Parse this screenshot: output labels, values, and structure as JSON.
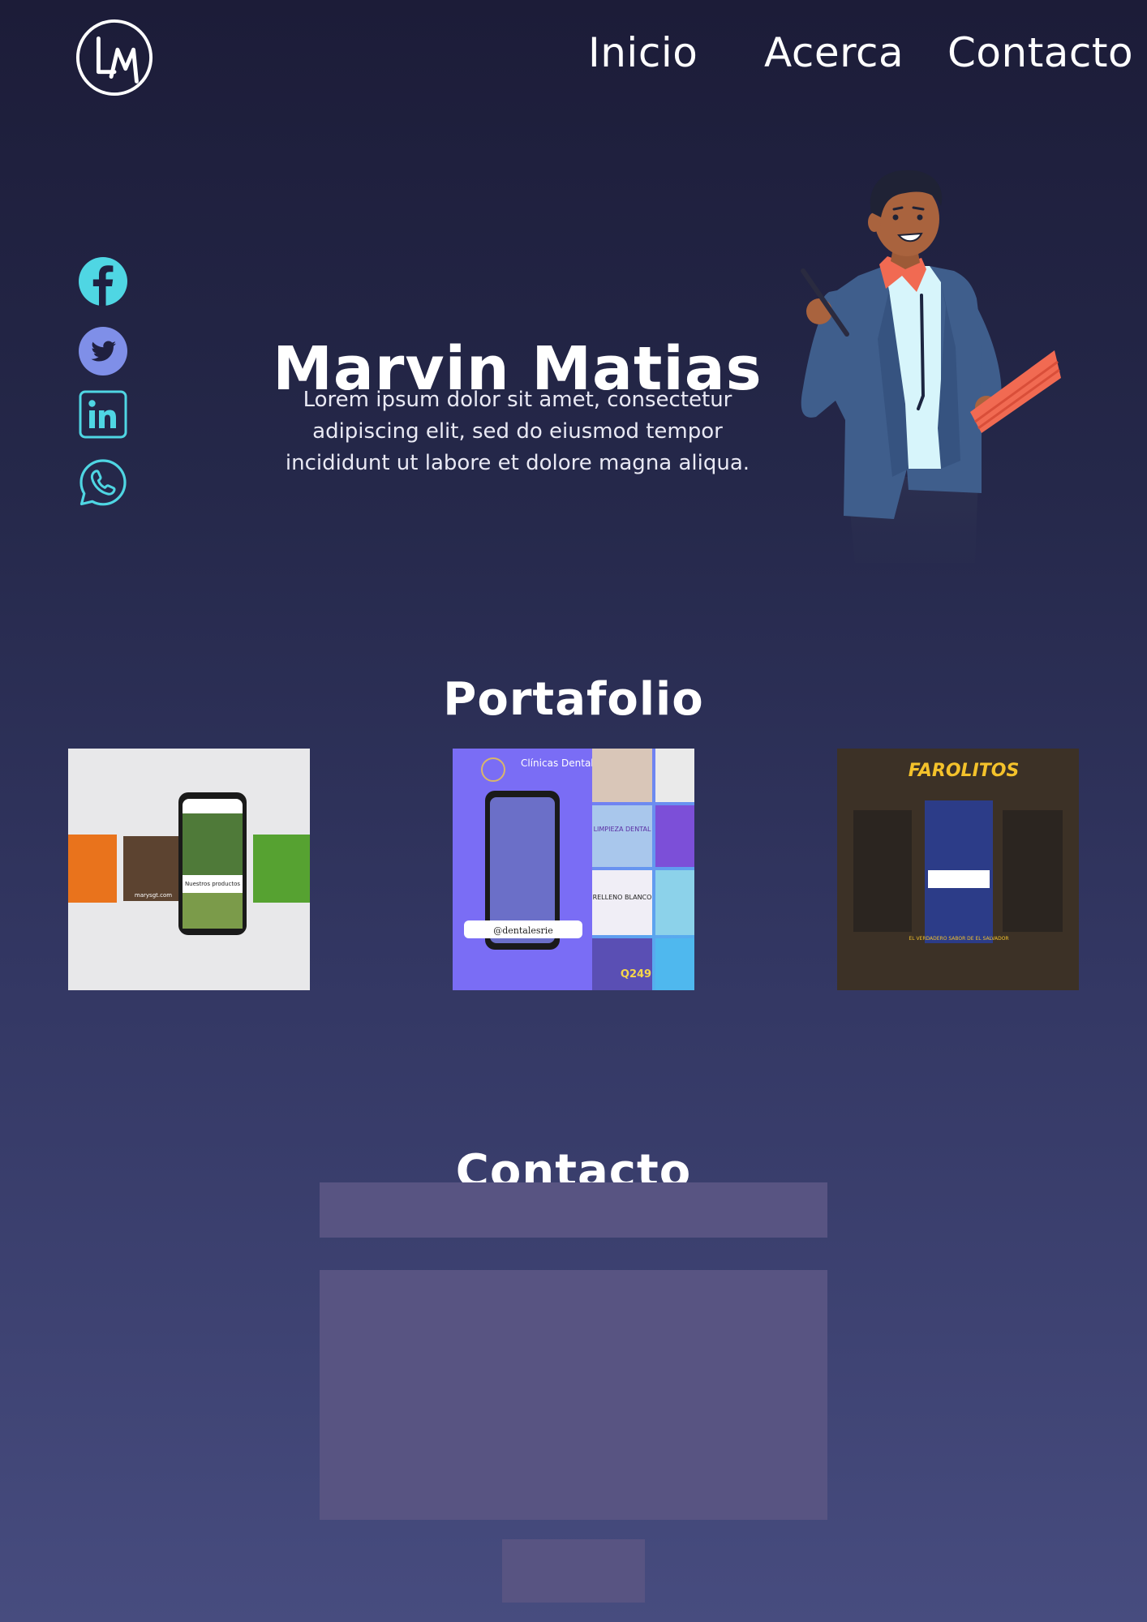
{
  "brand": {
    "logo_text": "LM",
    "logo_icon": "lm-monogram-icon"
  },
  "nav": {
    "items": [
      {
        "label": "Inicio"
      },
      {
        "label": "Acerca"
      },
      {
        "label": "Contacto"
      }
    ]
  },
  "social": {
    "items": [
      {
        "icon": "facebook-icon",
        "color": "#4fd6e3"
      },
      {
        "icon": "twitter-icon",
        "color": "#7f8fe8"
      },
      {
        "icon": "linkedin-icon",
        "color": "#4fd6e3"
      },
      {
        "icon": "whatsapp-icon",
        "color": "#4fd6e3"
      }
    ]
  },
  "hero": {
    "name": "Marvin Matias",
    "description": "Lorem ipsum dolor sit amet, consectetur adipiscing elit, sed do eiusmod tempor incididunt ut labore et dolore magna aliqua."
  },
  "portfolio": {
    "title": "Portafolio",
    "items": [
      {
        "name": "marys-gt-mockup",
        "caption": "Nuestros productos",
        "site": "marysgt.com"
      },
      {
        "name": "clinicas-dentales",
        "title": "Clínicas Dentales",
        "handle": "@dentalesrie",
        "offer_1": "LIMPIEZA DENTAL",
        "offer_2": "RELLENO BLANCO",
        "price": "Q249"
      },
      {
        "name": "los-farolitos",
        "title": "FAROLITOS",
        "tagline": "EL VERDADERO SABOR DE EL SALVADOR"
      }
    ]
  },
  "contact": {
    "title": "Contacto",
    "name_placeholder": "",
    "message_placeholder": "",
    "submit_label": ""
  },
  "colors": {
    "accent": "#4fd6e3",
    "field_bg": "#585482",
    "bg_top": "#1c1c38",
    "bg_bottom": "#474c7f"
  }
}
